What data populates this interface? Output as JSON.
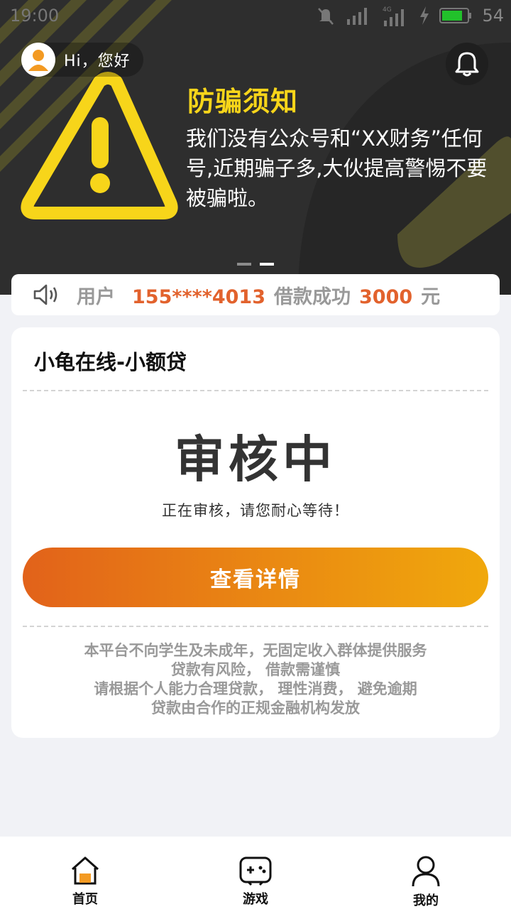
{
  "status_bar": {
    "time": "19:00",
    "battery_level": "54",
    "battery_color": "#22c12b",
    "icons": [
      "mute-icon",
      "signal-icon",
      "signal-4g-icon",
      "charging-icon",
      "battery-icon"
    ]
  },
  "header": {
    "greeting": "Hi，您好",
    "avatar_icon": "user-avatar-icon",
    "notification_icon": "bell-icon"
  },
  "banner": {
    "title": "防骗须知",
    "body": "我们没有公众号和“XX财务”任何号,近期骗子多,大伙提高警惕不要被骗啦。",
    "warning_icon": "warning-triangle-icon",
    "slide_count": 2,
    "active_slide": 2,
    "title_color": "#f7d51a"
  },
  "ticker": {
    "icon": "speaker-icon",
    "prefix": "用户",
    "phone": "155****4013",
    "middle": "借款成功",
    "amount": "3000",
    "unit": "元",
    "accent_color": "#e2622d"
  },
  "card": {
    "product_name": "小龟在线-小额贷",
    "status_title": "审核中",
    "status_subtitle": "正在审核，请您耐心等待！",
    "detail_button": "查看详情",
    "disclaimer": [
      "本平台不向学生及未成年，无固定收入群体提供服务",
      "贷款有风险， 借款需谨慎",
      "请根据个人能力合理贷款， 理性消费， 避免逾期",
      "贷款由合作的正规金融机构发放"
    ],
    "button_gradient": [
      "#e2621a",
      "#f0a80c"
    ]
  },
  "bottom_nav": {
    "items": [
      {
        "label": "首页",
        "icon": "home-icon",
        "active": true
      },
      {
        "label": "游戏",
        "icon": "gamepad-icon",
        "active": false
      },
      {
        "label": "我的",
        "icon": "profile-icon",
        "active": false
      }
    ],
    "active_color": "#f39a22"
  }
}
